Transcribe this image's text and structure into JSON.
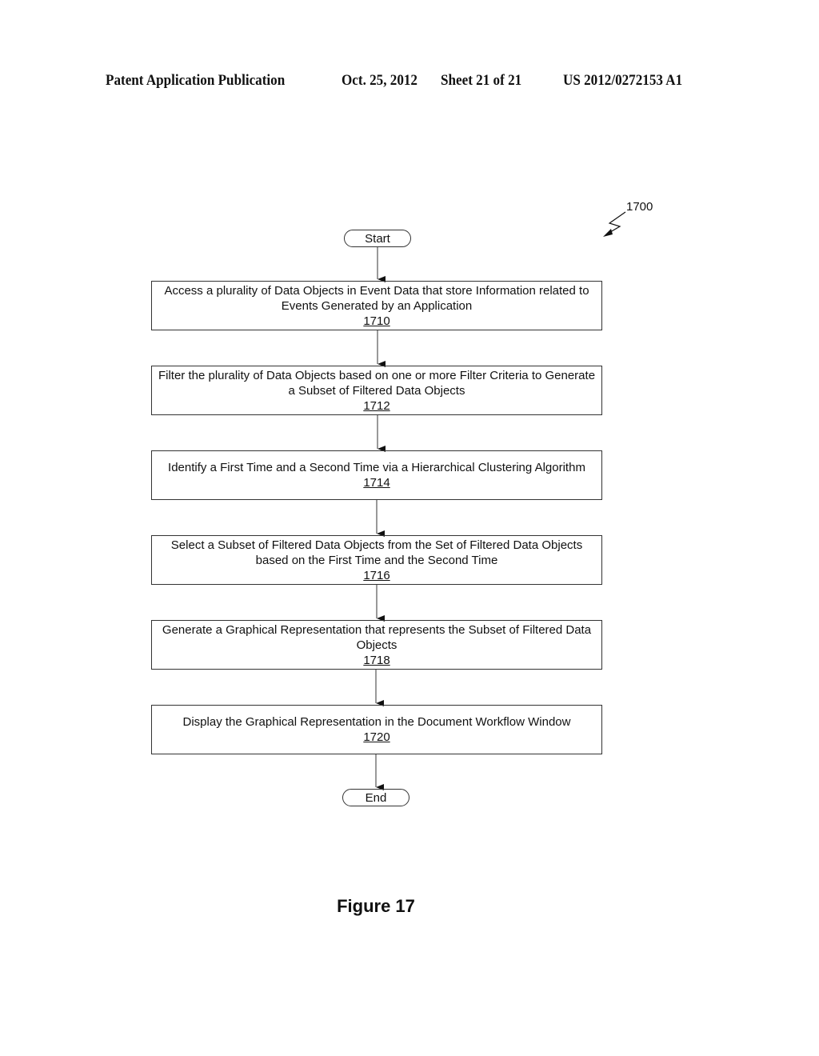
{
  "header": {
    "publication": "Patent Application Publication",
    "date": "Oct. 25, 2012",
    "sheet": "Sheet 21 of 21",
    "number": "US 2012/0272153 A1"
  },
  "diagram": {
    "ref": "1700",
    "start": "Start",
    "end": "End",
    "steps": [
      {
        "text": "Access a plurality of Data Objects in Event Data that store Information related to Events Generated by an Application",
        "ref": "1710"
      },
      {
        "text": "Filter the plurality of Data Objects based on one or more Filter Criteria to Generate a Subset of Filtered Data Objects",
        "ref": "1712"
      },
      {
        "text": "Identify a First Time and a Second Time via a Hierarchical Clustering Algorithm",
        "ref": "1714"
      },
      {
        "text": "Select a Subset of Filtered Data Objects from the Set of Filtered Data Objects based on the First Time and the Second Time",
        "ref": "1716"
      },
      {
        "text": "Generate a Graphical Representation that represents the Subset of Filtered Data Objects",
        "ref": "1718"
      },
      {
        "text": "Display the Graphical Representation in the Document Workflow Window",
        "ref": "1720"
      }
    ]
  },
  "figure_label": "Figure 17"
}
